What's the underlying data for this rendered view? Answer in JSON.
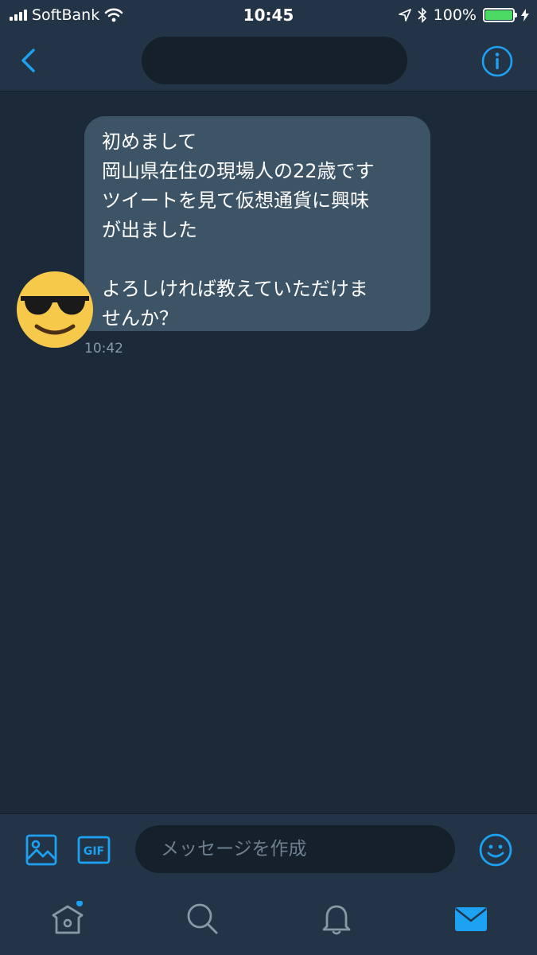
{
  "status_bar": {
    "carrier": "SoftBank",
    "time": "10:45",
    "battery": "100%",
    "battery_level": 1.0
  },
  "nav": {
    "back_icon": "chevron-left-icon",
    "info_icon": "info-icon"
  },
  "message": {
    "text": "初めまして\n岡山県在住の現場人の22歳です\nツイートを見て仮想通貨に興味\nが出ました\n\nよろしければ教えていただけま\nせんか？",
    "time": "10:42",
    "avatar": "sunglasses-emoji-avatar"
  },
  "composer": {
    "placeholder": "メッセージを作成",
    "gif_label": "GIF"
  },
  "tabs": [
    {
      "name": "home",
      "icon": "home-icon",
      "has_badge": true
    },
    {
      "name": "search",
      "icon": "search-icon"
    },
    {
      "name": "notifications",
      "icon": "bell-icon"
    },
    {
      "name": "messages",
      "icon": "envelope-icon",
      "active": true
    }
  ],
  "colors": {
    "accent": "#1da1f2",
    "background": "#1c2938",
    "bar": "#243447",
    "bubble": "#3d5466"
  }
}
